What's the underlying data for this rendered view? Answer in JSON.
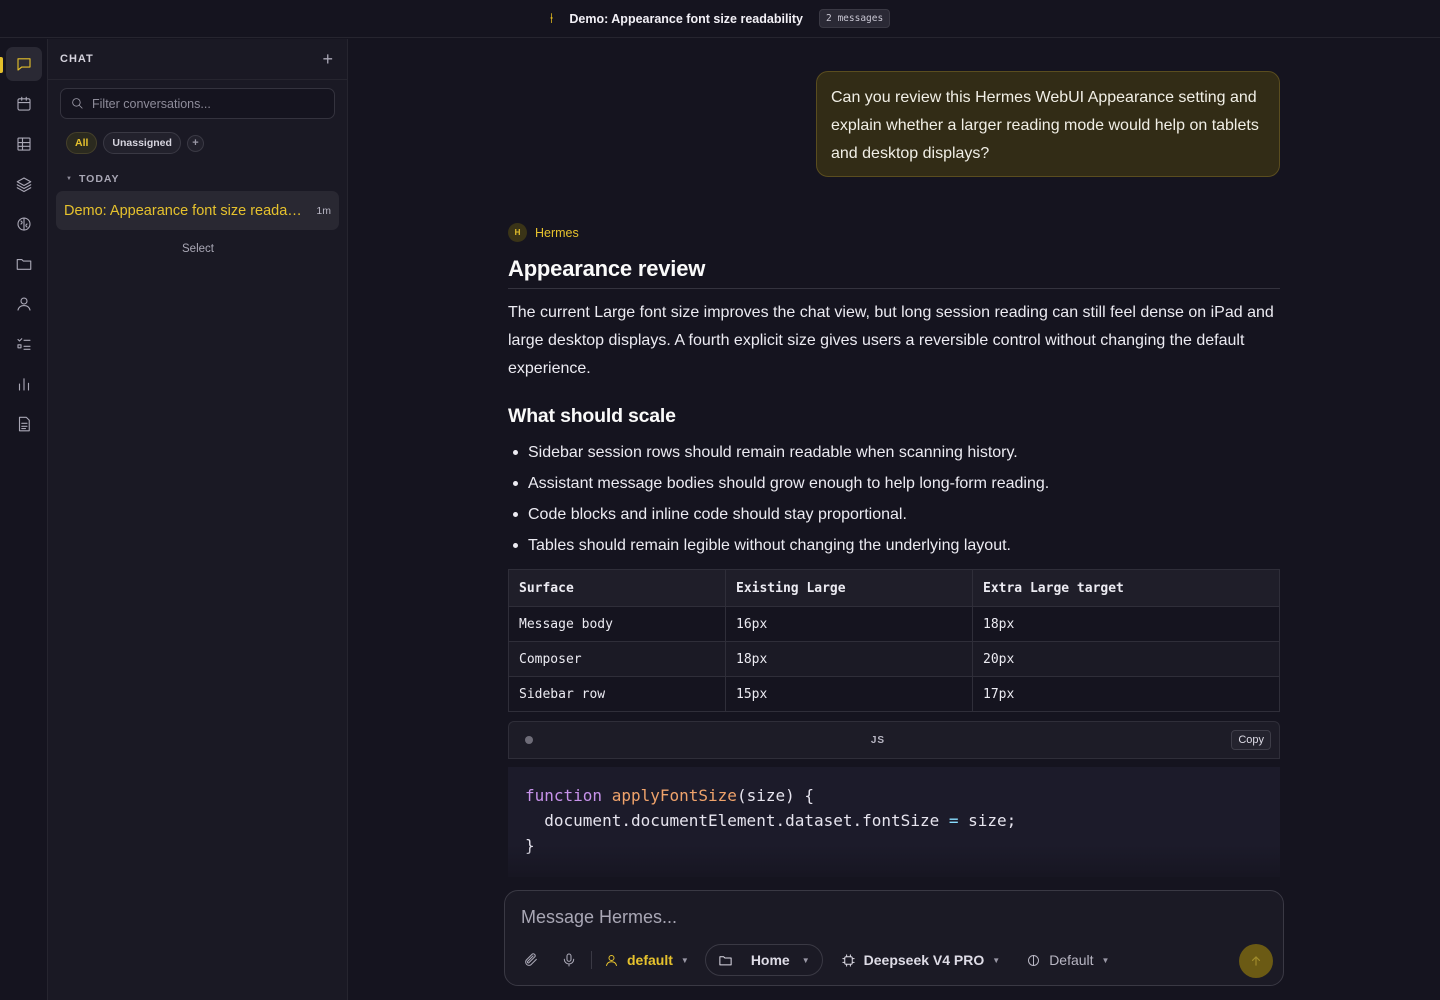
{
  "topbar": {
    "title": "Demo: Appearance font size readability",
    "message_count": "2 messages"
  },
  "rail": {
    "items": [
      "chat-icon",
      "calendar-icon",
      "grid-icon",
      "layers-icon",
      "brain-icon",
      "folder-icon",
      "user-icon",
      "checklist-icon",
      "bar-chart-icon",
      "document-icon"
    ],
    "settings": "gear-icon"
  },
  "sidebar": {
    "header_label": "CHAT",
    "new_label": "+",
    "search_placeholder": "Filter conversations...",
    "filters": [
      "All",
      "Unassigned"
    ],
    "add_filter_label": "+",
    "section_label": "TODAY",
    "conversations": [
      {
        "title": "Demo: Appearance font size readability",
        "age": "1m"
      }
    ],
    "select_label": "Select"
  },
  "conversation": {
    "user_message": "Can you review this Hermes WebUI Appearance setting and explain whether a larger reading mode would help on tablets and desktop displays?",
    "assistant": {
      "avatar_letter": "H",
      "name": "Hermes",
      "heading": "Appearance review",
      "intro": "The current Large font size improves the chat view, but long session reading can still feel dense on iPad and large desktop displays. A fourth explicit size gives users a reversible control without changing the default experience.",
      "subheading": "What should scale",
      "bullets": [
        "Sidebar session rows should remain readable when scanning history.",
        "Assistant message bodies should grow enough to help long-form reading.",
        "Code blocks and inline code should stay proportional.",
        "Tables should remain legible without changing the underlying layout."
      ],
      "table": {
        "headers": [
          "Surface",
          "Existing Large",
          "Extra Large target"
        ],
        "rows": [
          [
            "Message body",
            "16px",
            "18px"
          ],
          [
            "Composer",
            "18px",
            "20px"
          ],
          [
            "Sidebar row",
            "15px",
            "17px"
          ]
        ]
      },
      "code": {
        "language": "JS",
        "copy_label": "Copy",
        "lines": [
          {
            "kw": "function",
            "fn": "applyFontSize",
            "rest": "(size) {"
          },
          {
            "a": "  document.documentElement.dataset.fontSize ",
            "op": "=",
            "b": " size;"
          },
          {
            "text": "}"
          }
        ]
      }
    }
  },
  "composer": {
    "placeholder": "Message Hermes...",
    "profile": "default",
    "workspace": "Home",
    "model": "Deepseek V4 PRO",
    "mode": "Default"
  },
  "colors": {
    "accent": "#e6c22d",
    "background": "#15141f",
    "sidebar": "#1a1924",
    "user_bubble": "#322c16"
  }
}
